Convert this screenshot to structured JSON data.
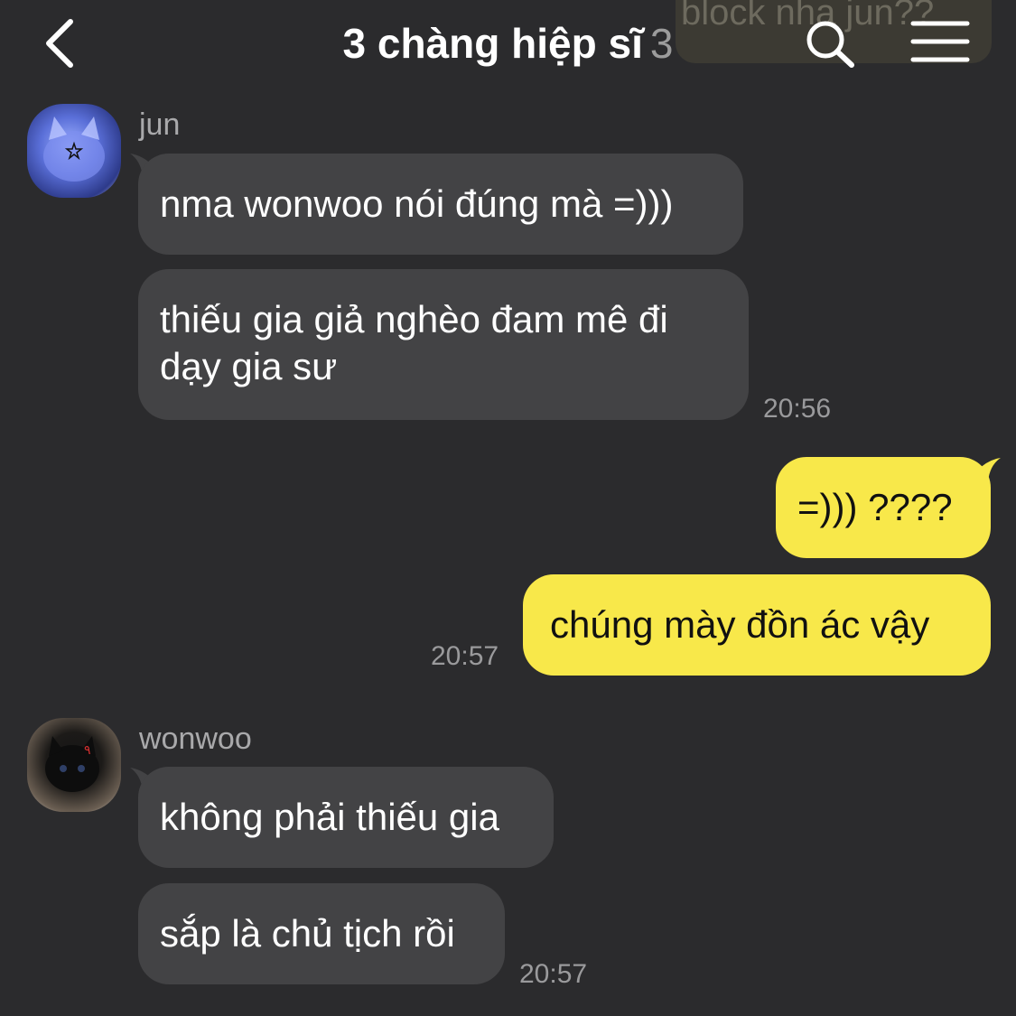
{
  "header": {
    "title": "3 chàng hiệp sĩ",
    "member_count": "3",
    "ghost_banner_text": "block nha jun??",
    "back_icon": "chevron-left-icon",
    "search_icon": "search-icon",
    "menu_icon": "hamburger-menu-icon"
  },
  "colors": {
    "background": "#2b2b2d",
    "incoming_bubble": "#434345",
    "outgoing_bubble": "#f8e84a",
    "timestamp": "#9a9a9c"
  },
  "messages": [
    {
      "sender": "jun",
      "direction": "incoming",
      "bubbles": [
        "nma wonwoo nói đúng mà =)))",
        "thiếu gia giả nghèo đam mê đi\ndạy gia sư"
      ],
      "time": "20:56"
    },
    {
      "sender": "",
      "direction": "outgoing",
      "bubbles": [
        "=))) ????",
        "chúng mày đồn ác vậy"
      ],
      "time": "20:57"
    },
    {
      "sender": "wonwoo",
      "direction": "incoming",
      "bubbles": [
        "không phải thiếu gia",
        "sắp là chủ tịch rồi"
      ],
      "time": "20:57"
    }
  ]
}
